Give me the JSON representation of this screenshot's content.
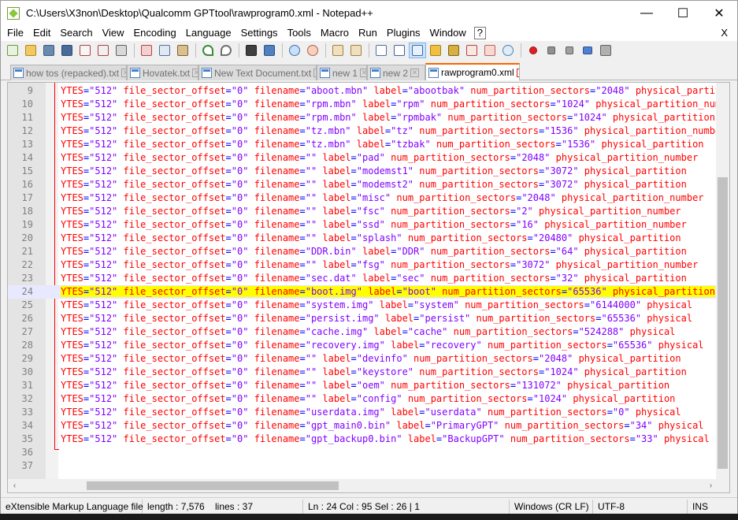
{
  "window": {
    "title": "C:\\Users\\X3non\\Desktop\\Qualcomm GPTtool\\rawprogram0.xml - Notepad++",
    "minimize": "—",
    "maximize": "☐",
    "close": "✕"
  },
  "menu": {
    "items": [
      "File",
      "Edit",
      "Search",
      "View",
      "Encoding",
      "Language",
      "Settings",
      "Tools",
      "Macro",
      "Run",
      "Plugins",
      "Window",
      "?"
    ],
    "close_doc": "X"
  },
  "tabs": [
    {
      "label": "how tos (repacked).txt",
      "active": false
    },
    {
      "label": "Hovatek.txt",
      "active": false
    },
    {
      "label": "New Text Document.txt",
      "active": false
    },
    {
      "label": "new 1",
      "active": false
    },
    {
      "label": "new 2",
      "active": false
    },
    {
      "label": "rawprogram0.xml",
      "active": true
    }
  ],
  "editor": {
    "current_line": 24,
    "lines": [
      {
        "n": "9",
        "text": "YTES=\"512\" file_sector_offset=\"0\" filename=\"aboot.mbn\" label=\"abootbak\" num_partition_sectors=\"2048\" physical_partition_number"
      },
      {
        "n": "10",
        "text": "YTES=\"512\" file_sector_offset=\"0\" filename=\"rpm.mbn\" label=\"rpm\" num_partition_sectors=\"1024\" physical_partition_number"
      },
      {
        "n": "11",
        "text": "YTES=\"512\" file_sector_offset=\"0\" filename=\"rpm.mbn\" label=\"rpmbak\" num_partition_sectors=\"1024\" physical_partition"
      },
      {
        "n": "12",
        "text": "YTES=\"512\" file_sector_offset=\"0\" filename=\"tz.mbn\" label=\"tz\" num_partition_sectors=\"1536\" physical_partition_number"
      },
      {
        "n": "13",
        "text": "YTES=\"512\" file_sector_offset=\"0\" filename=\"tz.mbn\" label=\"tzbak\" num_partition_sectors=\"1536\" physical_partition"
      },
      {
        "n": "14",
        "text": "YTES=\"512\" file_sector_offset=\"0\" filename=\"\" label=\"pad\" num_partition_sectors=\"2048\" physical_partition_number"
      },
      {
        "n": "15",
        "text": "YTES=\"512\" file_sector_offset=\"0\" filename=\"\" label=\"modemst1\" num_partition_sectors=\"3072\" physical_partition"
      },
      {
        "n": "16",
        "text": "YTES=\"512\" file_sector_offset=\"0\" filename=\"\" label=\"modemst2\" num_partition_sectors=\"3072\" physical_partition"
      },
      {
        "n": "17",
        "text": "YTES=\"512\" file_sector_offset=\"0\" filename=\"\" label=\"misc\" num_partition_sectors=\"2048\" physical_partition_number"
      },
      {
        "n": "18",
        "text": "YTES=\"512\" file_sector_offset=\"0\" filename=\"\" label=\"fsc\" num_partition_sectors=\"2\" physical_partition_number"
      },
      {
        "n": "19",
        "text": "YTES=\"512\" file_sector_offset=\"0\" filename=\"\" label=\"ssd\" num_partition_sectors=\"16\" physical_partition_number"
      },
      {
        "n": "20",
        "text": "YTES=\"512\" file_sector_offset=\"0\" filename=\"\" label=\"splash\" num_partition_sectors=\"20480\" physical_partition"
      },
      {
        "n": "21",
        "text": "YTES=\"512\" file_sector_offset=\"0\" filename=\"DDR.bin\" label=\"DDR\" num_partition_sectors=\"64\" physical_partition"
      },
      {
        "n": "22",
        "text": "YTES=\"512\" file_sector_offset=\"0\" filename=\"\" label=\"fsg\" num_partition_sectors=\"3072\" physical_partition_number"
      },
      {
        "n": "23",
        "text": "YTES=\"512\" file_sector_offset=\"0\" filename=\"sec.dat\" label=\"sec\" num_partition_sectors=\"32\" physical_partition"
      },
      {
        "n": "24",
        "text": "YTES=\"512\" file_sector_offset=\"0\" filename=\"boot.img\" label=\"boot\" num_partition_sectors=\"65536\" physical_partition"
      },
      {
        "n": "25",
        "text": "YTES=\"512\" file_sector_offset=\"0\" filename=\"system.img\" label=\"system\" num_partition_sectors=\"6144000\" physical"
      },
      {
        "n": "26",
        "text": "YTES=\"512\" file_sector_offset=\"0\" filename=\"persist.img\" label=\"persist\" num_partition_sectors=\"65536\" physical"
      },
      {
        "n": "27",
        "text": "YTES=\"512\" file_sector_offset=\"0\" filename=\"cache.img\" label=\"cache\" num_partition_sectors=\"524288\" physical"
      },
      {
        "n": "28",
        "text": "YTES=\"512\" file_sector_offset=\"0\" filename=\"recovery.img\" label=\"recovery\" num_partition_sectors=\"65536\" physical"
      },
      {
        "n": "29",
        "text": "YTES=\"512\" file_sector_offset=\"0\" filename=\"\" label=\"devinfo\" num_partition_sectors=\"2048\" physical_partition"
      },
      {
        "n": "30",
        "text": "YTES=\"512\" file_sector_offset=\"0\" filename=\"\" label=\"keystore\" num_partition_sectors=\"1024\" physical_partition"
      },
      {
        "n": "31",
        "text": "YTES=\"512\" file_sector_offset=\"0\" filename=\"\" label=\"oem\" num_partition_sectors=\"131072\" physical_partition"
      },
      {
        "n": "32",
        "text": "YTES=\"512\" file_sector_offset=\"0\" filename=\"\" label=\"config\" num_partition_sectors=\"1024\" physical_partition"
      },
      {
        "n": "33",
        "text": "YTES=\"512\" file_sector_offset=\"0\" filename=\"userdata.img\" label=\"userdata\" num_partition_sectors=\"0\" physical"
      },
      {
        "n": "34",
        "text": "YTES=\"512\" file_sector_offset=\"0\" filename=\"gpt_main0.bin\" label=\"PrimaryGPT\" num_partition_sectors=\"34\" physical"
      },
      {
        "n": "35",
        "text": "YTES=\"512\" file_sector_offset=\"0\" filename=\"gpt_backup0.bin\" label=\"BackupGPT\" num_partition_sectors=\"33\" physical"
      },
      {
        "n": "36",
        "text": ""
      },
      {
        "n": "37",
        "text": ""
      }
    ]
  },
  "status": {
    "file_type": "eXtensible Markup Language file",
    "length": "length : 7,576",
    "lines": "lines : 37",
    "position": "Ln : 24    Col : 95    Sel : 26 | 1",
    "eol": "Windows (CR LF)",
    "encoding": "UTF-8",
    "mode": "INS"
  },
  "colors": {
    "attr_name": "#ff0000",
    "attr_value": "#8000ff",
    "punct": "#0000ff",
    "active_tab_accent": "#fa6400"
  }
}
